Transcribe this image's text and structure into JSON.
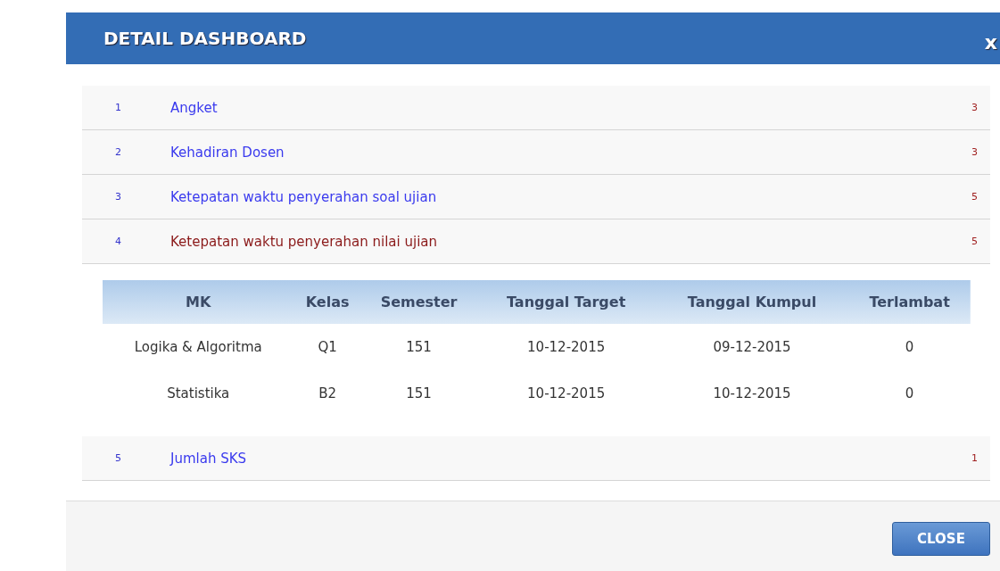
{
  "dialog": {
    "title": "DETAIL DASHBOARD",
    "close_icon": "x"
  },
  "items": [
    {
      "number": "1",
      "label": "Angket",
      "value": "3",
      "expanded": false
    },
    {
      "number": "2",
      "label": "Kehadiran Dosen",
      "value": "3",
      "expanded": false
    },
    {
      "number": "3",
      "label": "Ketepatan waktu penyerahan soal ujian",
      "value": "5",
      "expanded": false
    },
    {
      "number": "4",
      "label": "Ketepatan waktu penyerahan nilai ujian",
      "value": "5",
      "expanded": true,
      "table": {
        "columns": [
          "MK",
          "Kelas",
          "Semester",
          "Tanggal Target",
          "Tanggal Kumpul",
          "Terlambat"
        ],
        "rows": [
          [
            "Logika & Algoritma",
            "Q1",
            "151",
            "10-12-2015",
            "09-12-2015",
            "0"
          ],
          [
            "Statistika",
            "B2",
            "151",
            "10-12-2015",
            "10-12-2015",
            "0"
          ]
        ]
      }
    },
    {
      "number": "5",
      "label": "Jumlah SKS",
      "value": "1",
      "expanded": false
    }
  ],
  "footer": {
    "button": "CLOSE"
  }
}
